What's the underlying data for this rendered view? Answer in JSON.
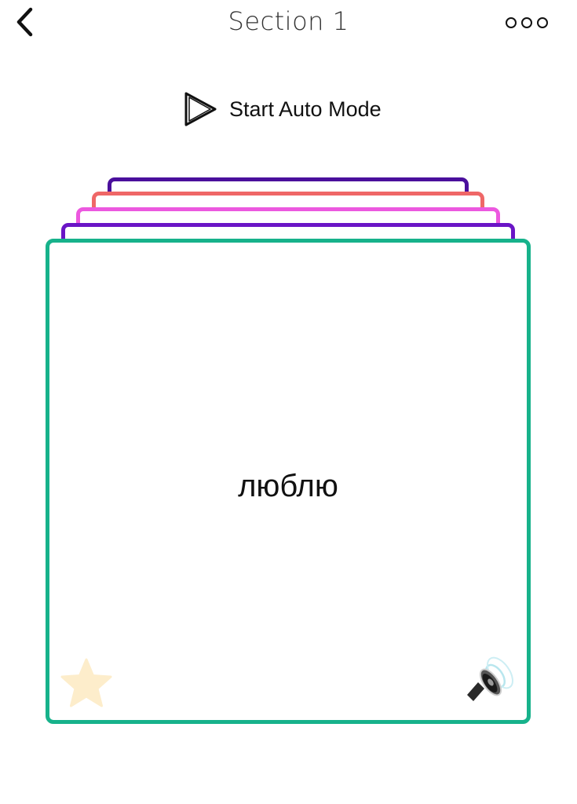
{
  "header": {
    "title": "Section 1",
    "back_icon": "chevron-left-icon",
    "more_icon": "more-circles-icon"
  },
  "auto_mode": {
    "label": "Start Auto Mode",
    "icon": "play-outline-icon"
  },
  "card": {
    "word": "люблю",
    "border_color": "#17b28b",
    "favorite_icon": "star-icon",
    "audio_icon": "speaker-icon"
  },
  "stack_colors": [
    "#4a0f9c",
    "#ef6767",
    "#ec58df",
    "#6a15c6"
  ]
}
